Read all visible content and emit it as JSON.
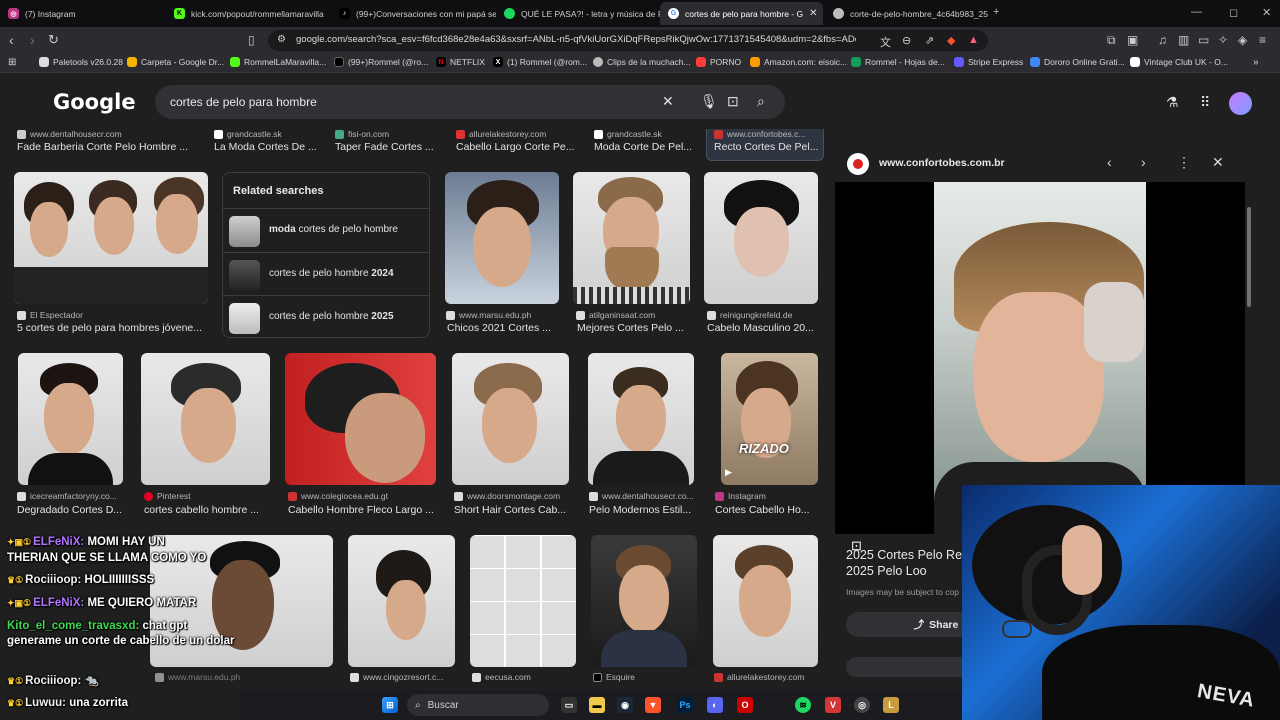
{
  "tabs": [
    {
      "label": "(7) Instagram",
      "color": "#c13584",
      "glyph": "◎"
    },
    {
      "label": "kick.com/popout/rommellamaravilla",
      "color": "#53fc18",
      "glyph": "K"
    },
    {
      "label": "(99+)Conversaciones con mi papá se",
      "color": "#ffffff",
      "glyph": "♪"
    },
    {
      "label": "QUÉ LE PASA?! - letra y música de F",
      "color": "#1ed760",
      "glyph": "●"
    },
    {
      "label": "cortes de pelo para hombre - G",
      "color": "#ffffff",
      "glyph": "G"
    },
    {
      "label": "corte-de-pelo-hombre_4c64b983_25",
      "color": "#bbbbbb",
      "glyph": "◐"
    }
  ],
  "url": "google.com/search?sca_esv=f6fcd368e28e4a63&sxsrf=ANbL-n5-qfVkiUorGXiDqFRepsRikQjwOw:1771371545408&udm=2&fbs=ADc_l-aN...",
  "bookmarks": [
    {
      "label": "Paletools v26.0.28",
      "color": "#dddddd"
    },
    {
      "label": "Carpeta - Google Dr...",
      "color": "#f4b400"
    },
    {
      "label": "RommelLaMaravilla...",
      "color": "#53fc18"
    },
    {
      "label": "(99+)Rommel (@ro...",
      "color": "#ffffff"
    },
    {
      "label": "NETFLIX",
      "color": "#e50914"
    },
    {
      "label": "(1) Rommel (@rom...",
      "color": "#ffffff"
    },
    {
      "label": "Clips de la muchach...",
      "color": "#bbbbbb"
    },
    {
      "label": "PORNO",
      "color": "#ff3d3d"
    },
    {
      "label": "Amazon.com: eisoic...",
      "color": "#ff9900"
    },
    {
      "label": "Rommel - Hojas de...",
      "color": "#0f9d58"
    },
    {
      "label": "Stripe Express",
      "color": "#635bff"
    },
    {
      "label": "Dororo Online Grati...",
      "color": "#4285f4"
    },
    {
      "label": "Vintage Club UK - O...",
      "color": "#ffffff"
    }
  ],
  "search": {
    "query": "cortes de pelo para hombre",
    "logo": "Google"
  },
  "row0": [
    {
      "site": "www.dentalhousecr.com",
      "title": "Fade Barberia Corte Pelo Hombre ..."
    },
    {
      "site": "grandcastle.sk",
      "title": "La Moda Cortes De ..."
    },
    {
      "site": "fisi-on.com",
      "title": "Taper Fade Cortes ..."
    },
    {
      "site": "allurelakestorey.com",
      "title": "Cabello Largo Corte Pe..."
    },
    {
      "site": "grandcastle.sk",
      "title": "Moda Corte De Pel..."
    },
    {
      "site": "www.confortobes.c...",
      "title": "Recto Cortes De Pel..."
    }
  ],
  "related": {
    "heading": "Related searches",
    "items": [
      {
        "bold": "moda",
        "rest": " cortes de pelo hombre"
      },
      {
        "pre": "cortes de pelo hombre ",
        "bold": "2024"
      },
      {
        "pre": "cortes de pelo hombre ",
        "bold": "2025"
      }
    ]
  },
  "row1": [
    {
      "site": "El Espectador",
      "title": "5 cortes de pelo para hombres jóvene..."
    },
    {
      "site": "www.marsu.edu.ph",
      "title": "Chicos 2021 Cortes ..."
    },
    {
      "site": "atilganinsaat.com",
      "title": "Mejores Cortes Pelo ..."
    },
    {
      "site": "reinigungkrefeld.de",
      "title": "Cabelo Masculino 20..."
    }
  ],
  "row2": [
    {
      "site": "icecreamfactoryny.co...",
      "title": "Degradado Cortes D..."
    },
    {
      "site": "Pinterest",
      "title": "cortes cabello hombre ..."
    },
    {
      "site": "www.colegiocea.edu.gt",
      "title": "Cabello Hombre Fleco Largo ..."
    },
    {
      "site": "www.doorsmontage.com",
      "title": "Short Hair Cortes Cab..."
    },
    {
      "site": "www.dentalhousecr.co...",
      "title": "Pelo Modernos Estil..."
    },
    {
      "site": "Instagram",
      "title": "Cortes Cabello Ho...",
      "overlay": "RIZADO"
    }
  ],
  "row3": [
    {
      "site": "www.marsu.edu.ph"
    },
    {
      "site": "www.cingozresort.c..."
    },
    {
      "site": "eecusa.com"
    },
    {
      "site": "Esquire"
    },
    {
      "site": "allurelakestorey.com"
    }
  ],
  "panel": {
    "site": "www.confortobes.com.br",
    "title": "2025 Cortes Pelo Re 2025 2025 Pelo Loo",
    "copyright": "Images may be subject to cop",
    "share": "Share"
  },
  "chat": [
    {
      "user": "ELFeNiX:",
      "text": " MOMI HAY UN",
      "ucls": "user-p"
    },
    {
      "user": "",
      "text": "THERIAN QUE SE LLAMA COMO YO",
      "ucls": "user-w"
    },
    {
      "user": "Rociiioop:",
      "text": " HOLIIIIIIISSS",
      "ucls": "user-w"
    },
    {
      "user": "ELFeNiX:",
      "text": " ME QUIERO MATAR",
      "ucls": "user-p"
    },
    {
      "user": "Kito_el_come_travasxd:",
      "text": " chat gpt generame un corte de cabello de un dolar",
      "ucls": "user-g"
    },
    {
      "user": "Rociiioop:",
      "text": " 🐀",
      "ucls": "user-w"
    },
    {
      "user": "Luwuu:",
      "text": " una zorrita",
      "ucls": "user-w"
    }
  ],
  "taskbar": {
    "search": "Buscar"
  },
  "webcam": {
    "shirt_text": "NEVA"
  }
}
